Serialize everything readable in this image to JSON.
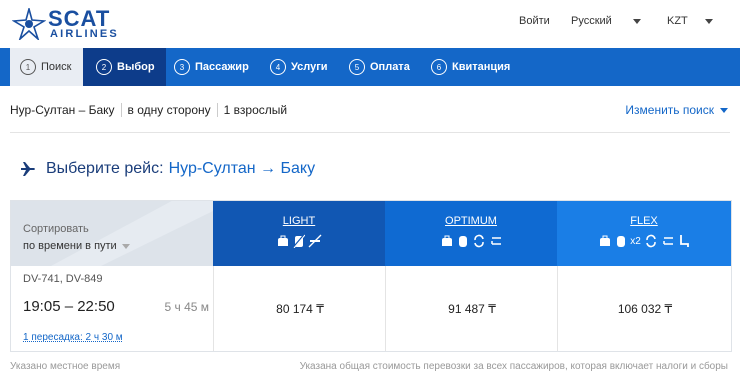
{
  "header": {
    "logo_name": "SCAT",
    "logo_sub": "AIRLINES",
    "login": "Войти",
    "language": "Русский",
    "currency": "KZT"
  },
  "steps": [
    {
      "num": "1",
      "label": "Поиск",
      "state": "done"
    },
    {
      "num": "2",
      "label": "Выбор",
      "state": "current"
    },
    {
      "num": "3",
      "label": "Пассажир",
      "state": "todo"
    },
    {
      "num": "4",
      "label": "Услуги",
      "state": "todo"
    },
    {
      "num": "5",
      "label": "Оплата",
      "state": "todo"
    },
    {
      "num": "6",
      "label": "Квитанция",
      "state": "todo"
    }
  ],
  "summary": {
    "route": "Нур-Султан – Баку",
    "trip_type": "в одну сторону",
    "passengers": "1 взрослый",
    "change_search": "Изменить поиск"
  },
  "title": {
    "prefix": "Выберите рейс:",
    "from": "Нур-Султан",
    "arrow": "→",
    "to": "Баку"
  },
  "sort": {
    "label": "Сортировать",
    "value": "по времени в пути"
  },
  "fares": [
    {
      "name": "LIGHT",
      "color": "#1157b3",
      "icons": [
        "bag-icon",
        "no-bag-icon",
        "no-change-icon"
      ]
    },
    {
      "name": "OPTIMUM",
      "color": "#0f6ad2",
      "icons": [
        "bag-icon",
        "suitcase-icon",
        "change-icon",
        "refund-icon"
      ]
    },
    {
      "name": "FLEX",
      "color": "#1a7ee6",
      "icons": [
        "bag-icon",
        "suitcase-x2-icon",
        "change-icon",
        "refund-icon",
        "seat-icon"
      ],
      "suitcase_count": "x2"
    }
  ],
  "flight": {
    "numbers": "DV-741, DV-849",
    "times": "19:05 – 22:50",
    "duration": "5 ч 45 м",
    "stops": "1 пересадка: 2 ч 30 м",
    "prices": [
      "80 174 ₸",
      "91 487 ₸",
      "106 032 ₸"
    ]
  },
  "footer": {
    "left": "Указано местное время",
    "right": "Указана общая стоимость перевозки за всех пассажиров, которая включает налоги и сборы"
  }
}
